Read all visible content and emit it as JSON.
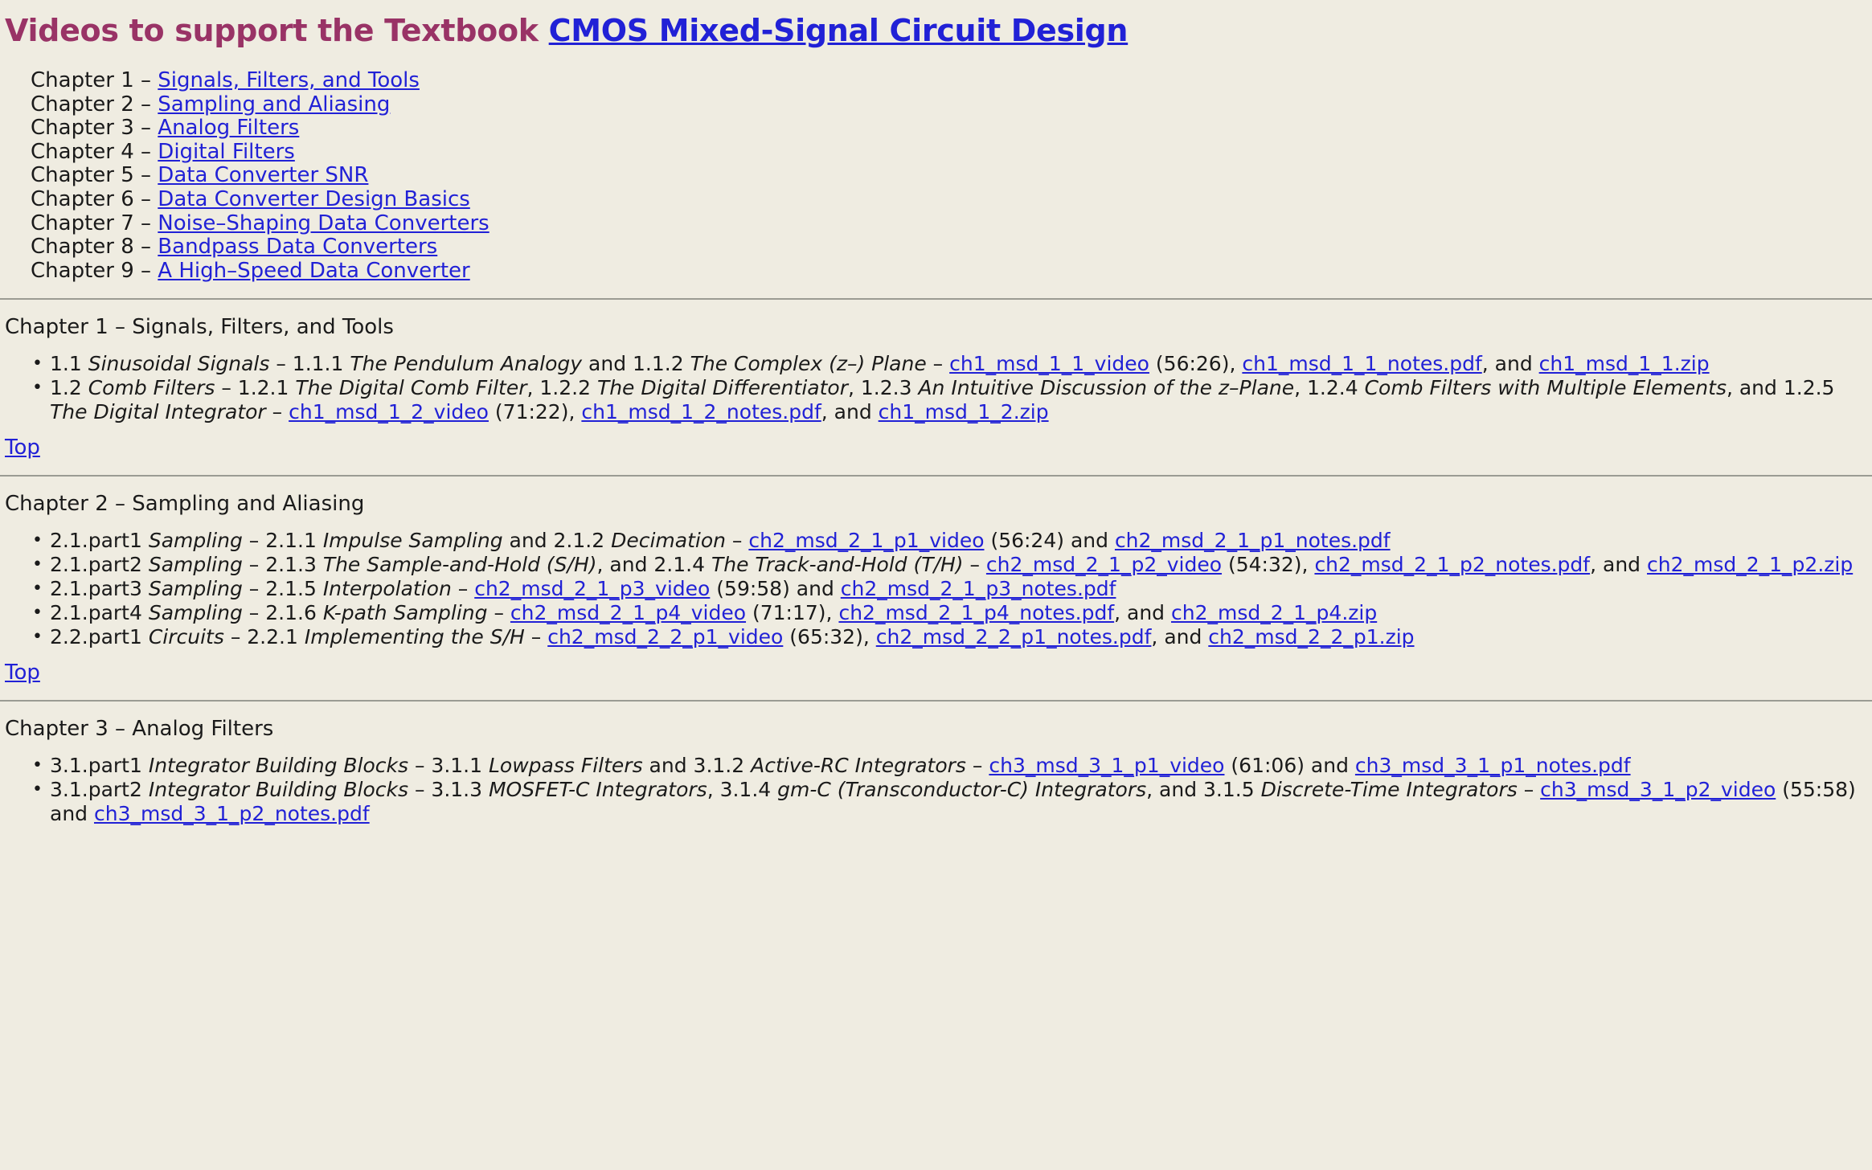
{
  "title": {
    "prefix": "Videos to support the Textbook ",
    "book_link": "CMOS Mixed-Signal Circuit Design"
  },
  "chapter_index": [
    {
      "label": "Chapter 1 – ",
      "link": "Signals, Filters, and Tools"
    },
    {
      "label": "Chapter 2 – ",
      "link": "Sampling and Aliasing"
    },
    {
      "label": "Chapter 3 – ",
      "link": "Analog Filters"
    },
    {
      "label": "Chapter 4 – ",
      "link": "Digital Filters"
    },
    {
      "label": "Chapter 5 – ",
      "link": "Data Converter SNR"
    },
    {
      "label": "Chapter 6 – ",
      "link": "Data Converter Design Basics"
    },
    {
      "label": "Chapter 7 – ",
      "link": "Noise–Shaping Data Converters"
    },
    {
      "label": "Chapter 8 – ",
      "link": "Bandpass Data Converters"
    },
    {
      "label": "Chapter 9 – ",
      "link": "A High–Speed Data Converter"
    }
  ],
  "top_link": "Top",
  "sections": [
    {
      "heading": "Chapter 1 – Signals, Filters, and Tools",
      "items": [
        {
          "parts": [
            {
              "t": "text",
              "v": "1.1 "
            },
            {
              "t": "ital",
              "v": "Sinusoidal Signals"
            },
            {
              "t": "text",
              "v": " – 1.1.1 "
            },
            {
              "t": "ital",
              "v": "The Pendulum Analogy"
            },
            {
              "t": "text",
              "v": " and 1.1.2 "
            },
            {
              "t": "ital",
              "v": "The Complex (z–) Plane"
            },
            {
              "t": "text",
              "v": " – "
            },
            {
              "t": "link",
              "v": "ch1_msd_1_1_video"
            },
            {
              "t": "text",
              "v": " (56:26), "
            },
            {
              "t": "link",
              "v": "ch1_msd_1_1_notes.pdf"
            },
            {
              "t": "text",
              "v": ", and "
            },
            {
              "t": "link",
              "v": "ch1_msd_1_1.zip"
            }
          ]
        },
        {
          "parts": [
            {
              "t": "text",
              "v": "1.2 "
            },
            {
              "t": "ital",
              "v": "Comb Filters"
            },
            {
              "t": "text",
              "v": " – 1.2.1 "
            },
            {
              "t": "ital",
              "v": "The Digital Comb Filter"
            },
            {
              "t": "text",
              "v": ", 1.2.2 "
            },
            {
              "t": "ital",
              "v": "The Digital Differentiator"
            },
            {
              "t": "text",
              "v": ", 1.2.3 "
            },
            {
              "t": "ital",
              "v": "An Intuitive Discussion of the z–Plane"
            },
            {
              "t": "text",
              "v": ", 1.2.4 "
            },
            {
              "t": "ital",
              "v": "Comb Filters with Multiple Elements"
            },
            {
              "t": "text",
              "v": ", and 1.2.5 "
            },
            {
              "t": "ital",
              "v": "The Digital Integrator"
            },
            {
              "t": "text",
              "v": " – "
            },
            {
              "t": "link",
              "v": "ch1_msd_1_2_video"
            },
            {
              "t": "text",
              "v": " (71:22), "
            },
            {
              "t": "link",
              "v": "ch1_msd_1_2_notes.pdf"
            },
            {
              "t": "text",
              "v": ", and "
            },
            {
              "t": "link",
              "v": "ch1_msd_1_2.zip"
            }
          ]
        }
      ]
    },
    {
      "heading": "Chapter 2 – Sampling and Aliasing",
      "items": [
        {
          "parts": [
            {
              "t": "text",
              "v": "2.1.part1 "
            },
            {
              "t": "ital",
              "v": "Sampling"
            },
            {
              "t": "text",
              "v": " – 2.1.1 "
            },
            {
              "t": "ital",
              "v": "Impulse Sampling"
            },
            {
              "t": "text",
              "v": " and 2.1.2 "
            },
            {
              "t": "ital",
              "v": "Decimation"
            },
            {
              "t": "text",
              "v": " – "
            },
            {
              "t": "link",
              "v": "ch2_msd_2_1_p1_video"
            },
            {
              "t": "text",
              "v": " (56:24) and "
            },
            {
              "t": "link",
              "v": "ch2_msd_2_1_p1_notes.pdf"
            }
          ]
        },
        {
          "parts": [
            {
              "t": "text",
              "v": "2.1.part2 "
            },
            {
              "t": "ital",
              "v": "Sampling"
            },
            {
              "t": "text",
              "v": " – 2.1.3 "
            },
            {
              "t": "ital",
              "v": "The Sample-and-Hold (S/H)"
            },
            {
              "t": "text",
              "v": ", and 2.1.4 "
            },
            {
              "t": "ital",
              "v": "The Track-and-Hold (T/H)"
            },
            {
              "t": "text",
              "v": " – "
            },
            {
              "t": "link",
              "v": "ch2_msd_2_1_p2_video"
            },
            {
              "t": "text",
              "v": " (54:32), "
            },
            {
              "t": "link",
              "v": "ch2_msd_2_1_p2_notes.pdf"
            },
            {
              "t": "text",
              "v": ", and "
            },
            {
              "t": "link",
              "v": "ch2_msd_2_1_p2.zip"
            }
          ]
        },
        {
          "parts": [
            {
              "t": "text",
              "v": "2.1.part3 "
            },
            {
              "t": "ital",
              "v": "Sampling"
            },
            {
              "t": "text",
              "v": " – 2.1.5 "
            },
            {
              "t": "ital",
              "v": "Interpolation"
            },
            {
              "t": "text",
              "v": " – "
            },
            {
              "t": "link",
              "v": "ch2_msd_2_1_p3_video"
            },
            {
              "t": "text",
              "v": " (59:58) and "
            },
            {
              "t": "link",
              "v": "ch2_msd_2_1_p3_notes.pdf"
            }
          ]
        },
        {
          "parts": [
            {
              "t": "text",
              "v": "2.1.part4 "
            },
            {
              "t": "ital",
              "v": "Sampling"
            },
            {
              "t": "text",
              "v": " – 2.1.6 "
            },
            {
              "t": "ital",
              "v": "K-path Sampling"
            },
            {
              "t": "text",
              "v": " – "
            },
            {
              "t": "link",
              "v": "ch2_msd_2_1_p4_video"
            },
            {
              "t": "text",
              "v": " (71:17), "
            },
            {
              "t": "link",
              "v": "ch2_msd_2_1_p4_notes.pdf"
            },
            {
              "t": "text",
              "v": ", and "
            },
            {
              "t": "link",
              "v": "ch2_msd_2_1_p4.zip"
            }
          ]
        },
        {
          "parts": [
            {
              "t": "text",
              "v": "2.2.part1 "
            },
            {
              "t": "ital",
              "v": "Circuits"
            },
            {
              "t": "text",
              "v": " – 2.2.1 "
            },
            {
              "t": "ital",
              "v": "Implementing the S/H"
            },
            {
              "t": "text",
              "v": " – "
            },
            {
              "t": "link",
              "v": "ch2_msd_2_2_p1_video"
            },
            {
              "t": "text",
              "v": " (65:32), "
            },
            {
              "t": "link",
              "v": "ch2_msd_2_2_p1_notes.pdf"
            },
            {
              "t": "text",
              "v": ", and "
            },
            {
              "t": "link",
              "v": "ch2_msd_2_2_p1.zip"
            }
          ]
        }
      ]
    },
    {
      "heading": "Chapter 3 – Analog Filters",
      "items": [
        {
          "parts": [
            {
              "t": "text",
              "v": "3.1.part1 "
            },
            {
              "t": "ital",
              "v": "Integrator Building Blocks"
            },
            {
              "t": "text",
              "v": " – 3.1.1 "
            },
            {
              "t": "ital",
              "v": "Lowpass Filters"
            },
            {
              "t": "text",
              "v": " and 3.1.2 "
            },
            {
              "t": "ital",
              "v": "Active-RC Integrators"
            },
            {
              "t": "text",
              "v": " – "
            },
            {
              "t": "link",
              "v": "ch3_msd_3_1_p1_video"
            },
            {
              "t": "text",
              "v": " (61:06) and "
            },
            {
              "t": "link",
              "v": "ch3_msd_3_1_p1_notes.pdf"
            }
          ]
        },
        {
          "parts": [
            {
              "t": "text",
              "v": "3.1.part2 "
            },
            {
              "t": "ital",
              "v": "Integrator Building Blocks"
            },
            {
              "t": "text",
              "v": " – 3.1.3 "
            },
            {
              "t": "ital",
              "v": "MOSFET-C Integrators"
            },
            {
              "t": "text",
              "v": ", 3.1.4 "
            },
            {
              "t": "ital",
              "v": "gm-C (Transconductor-C) Integrators"
            },
            {
              "t": "text",
              "v": ", and 3.1.5 "
            },
            {
              "t": "ital",
              "v": "Discrete-Time Integrators"
            },
            {
              "t": "text",
              "v": " – "
            },
            {
              "t": "link",
              "v": "ch3_msd_3_1_p2_video"
            },
            {
              "t": "text",
              "v": " (55:58) and "
            },
            {
              "t": "link",
              "v": "ch3_msd_3_1_p2_notes.pdf"
            }
          ]
        }
      ]
    }
  ]
}
